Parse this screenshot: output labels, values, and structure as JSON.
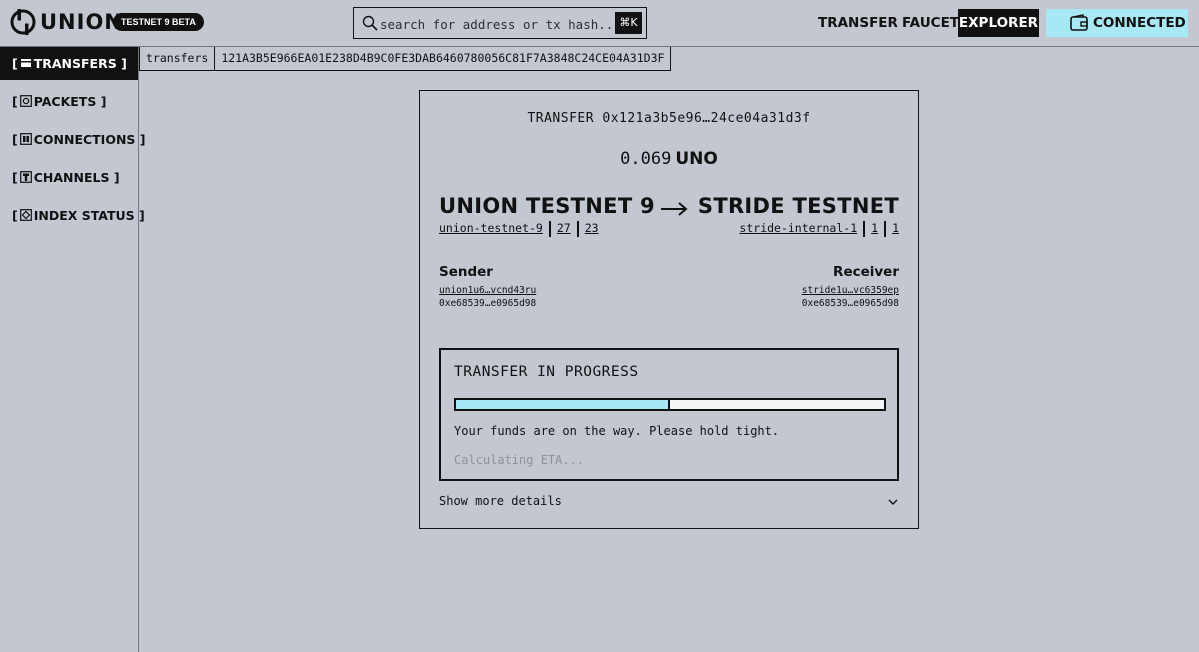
{
  "header": {
    "logo_text": "UNION",
    "badge": "TESTNET 9 BETA",
    "search": {
      "placeholder": "search for address or tx hash...",
      "value": "",
      "shortcut": "⌘K"
    },
    "nav": {
      "transfer": "TRANSFER",
      "faucet": "FAUCET",
      "explorer": "EXPLORER",
      "connected": "CONNECTED"
    },
    "icons": {
      "logo": "union-logo-icon",
      "search": "search-icon",
      "wallet": "wallet-icon"
    }
  },
  "sidebar": {
    "items": [
      {
        "label": "TRANSFERS",
        "icon": "transfers-icon",
        "active": true
      },
      {
        "label": "PACKETS",
        "icon": "packets-icon",
        "active": false
      },
      {
        "label": "CONNECTIONS",
        "icon": "connections-icon",
        "active": false
      },
      {
        "label": "CHANNELS",
        "icon": "channels-icon",
        "active": false
      },
      {
        "label": "INDEX STATUS",
        "icon": "index-status-icon",
        "active": false
      }
    ]
  },
  "breadcrumb": {
    "section": "transfers",
    "hash": "121A3B5E966EA01E238D4B9C0FE3DAB6460780056C81F7A3848C24CE04A31D3F"
  },
  "transfer": {
    "title": "TRANSFER 0x121a3b5e96…24ce04a31d3f",
    "amount": "0.069",
    "denom": "UNO",
    "from_chain": {
      "name": "UNION TESTNET 9",
      "chain_id": "union-testnet-9",
      "connection": "27",
      "channel": "23"
    },
    "to_chain": {
      "name": "STRIDE TESTNET",
      "chain_id": "stride-internal-1",
      "connection": "1",
      "channel": "1"
    },
    "sender": {
      "label": "Sender",
      "address": "union1u6…vcnd43ru",
      "hex": "0xe68539…e0965d98"
    },
    "receiver": {
      "label": "Receiver",
      "address": "stride1u…vc6359ep",
      "hex": "0xe68539…e0965d98"
    },
    "progress": {
      "title": "TRANSFER IN PROGRESS",
      "fraction": 0.5,
      "message": "Your funds are on the way. Please hold tight.",
      "eta": "Calculating ETA..."
    },
    "more_details": "Show more details"
  },
  "colors": {
    "background": "#c2c7d0",
    "accent": "#a7e8f4",
    "dark": "#111111",
    "muted_text": "#8d929a"
  }
}
